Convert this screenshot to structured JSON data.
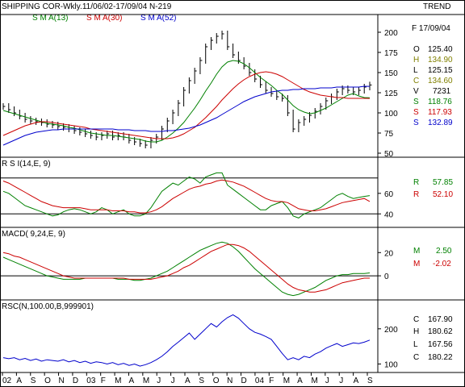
{
  "title": "SHIPPING COR-Wkly.11/06/02-17/09/04  N-219",
  "trend_label": "TREND",
  "colors": {
    "price": "#000000",
    "sma13": "#008000",
    "sma30": "#cc0000",
    "sma52": "#0000cc",
    "rsi": "#008000",
    "rsi_avg": "#cc0000",
    "macd": "#008000",
    "macd_signal": "#cc0000",
    "rsc": "#0000cc"
  },
  "legend": [
    {
      "label": "S M A(13)",
      "color": "#008000"
    },
    {
      "label": "S M A(30)",
      "color": "#cc0000"
    },
    {
      "label": "S M A(52)",
      "color": "#0000cc"
    }
  ],
  "readouts": {
    "date": "F 17/09/04",
    "price": [
      {
        "label": "O",
        "value": "125.40",
        "color": "#000000"
      },
      {
        "label": "H",
        "value": "134.90",
        "color": "#808000"
      },
      {
        "label": "L",
        "value": "125.15",
        "color": "#000000"
      },
      {
        "label": "C",
        "value": "134.60",
        "color": "#808000"
      },
      {
        "label": "V",
        "value": "7231",
        "color": "#000000"
      },
      {
        "label": "S",
        "value": "118.76",
        "color": "#008000"
      },
      {
        "label": "S",
        "value": "117.93",
        "color": "#cc0000"
      },
      {
        "label": "S",
        "value": "132.89",
        "color": "#0000cc"
      }
    ],
    "rsi": [
      {
        "label": "R",
        "value": "57.85",
        "color": "#008000"
      },
      {
        "label": "R",
        "value": "52.10",
        "color": "#cc0000"
      }
    ],
    "macd": [
      {
        "label": "M",
        "value": "2.50",
        "color": "#008000"
      },
      {
        "label": "M",
        "value": "-2.02",
        "color": "#cc0000"
      }
    ],
    "rsc": [
      {
        "label": "C",
        "value": "167.90",
        "color": "#000000"
      },
      {
        "label": "H",
        "value": "180.62",
        "color": "#000000"
      },
      {
        "label": "L",
        "value": "167.56",
        "color": "#000000"
      },
      {
        "label": "C",
        "value": "180.22",
        "color": "#000000"
      }
    ]
  },
  "chart_data": [
    {
      "type": "line",
      "panel": "price",
      "title": "SHIPPING COR-Wkly.11/06/02-17/09/04  N-219",
      "y_ticks": [
        50,
        75,
        100,
        125,
        150,
        175,
        200
      ],
      "ylim": [
        50,
        210
      ],
      "x_labels": [
        "02",
        "A",
        "S",
        "O",
        "N",
        "D",
        "03",
        "F",
        "M",
        "A",
        "M",
        "J",
        "J",
        "A",
        "S",
        "O",
        "N",
        "D",
        "04",
        "F",
        "M",
        "A",
        "M",
        "J",
        "J",
        "A",
        "S"
      ],
      "series": [
        {
          "name": "Price",
          "style": "bars",
          "values": [
            108,
            104,
            100,
            96,
            92,
            90,
            89,
            88,
            86,
            85,
            83,
            82,
            80,
            78,
            76,
            74,
            72,
            70,
            72,
            74,
            70,
            72,
            70,
            66,
            64,
            62,
            60,
            66,
            70,
            80,
            90,
            100,
            112,
            128,
            140,
            152,
            165,
            182,
            190,
            195,
            198,
            182,
            172,
            165,
            158,
            150,
            142,
            135,
            128,
            124,
            120,
            118,
            100,
            80,
            88,
            92,
            97,
            102,
            108,
            115,
            120,
            126,
            130,
            128,
            126,
            128,
            132,
            134.6
          ]
        },
        {
          "name": "S M A(13)",
          "values": [
            103,
            101,
            99,
            97,
            95,
            93,
            91,
            89,
            87,
            86,
            85,
            84,
            82,
            81,
            79,
            77,
            75,
            74,
            73,
            72,
            72,
            71,
            70,
            69,
            68,
            67,
            65,
            64,
            64,
            66,
            70,
            75,
            81,
            88,
            97,
            106,
            116,
            127,
            137,
            148,
            157,
            163,
            165,
            164,
            161,
            156,
            150,
            144,
            139,
            134,
            128,
            123,
            116,
            109,
            104,
            101,
            99,
            100,
            103,
            106,
            110,
            114,
            118,
            122,
            124,
            121,
            119,
            118.76
          ]
        },
        {
          "name": "S M A(30)",
          "values": [
            72,
            75,
            78,
            81,
            84,
            86,
            88,
            89,
            89,
            88,
            87,
            86,
            85,
            84,
            83,
            82,
            80,
            79,
            78,
            77,
            76,
            75,
            74,
            73,
            72,
            71,
            70,
            69,
            68,
            68,
            68,
            69,
            71,
            74,
            78,
            82,
            88,
            94,
            101,
            108,
            116,
            123,
            130,
            136,
            141,
            145,
            148,
            150,
            151,
            150,
            148,
            145,
            141,
            137,
            133,
            129,
            126,
            124,
            122,
            121,
            120,
            119,
            119,
            118,
            118,
            118,
            118,
            117.93
          ]
        },
        {
          "name": "S M A(52)",
          "values": [
            60,
            63,
            66,
            69,
            72,
            74,
            76,
            77,
            78,
            79,
            79,
            80,
            80,
            80,
            80,
            80,
            80,
            80,
            80,
            80,
            80,
            79,
            79,
            79,
            78,
            78,
            78,
            77,
            77,
            77,
            78,
            78,
            79,
            80,
            81,
            83,
            85,
            88,
            91,
            94,
            98,
            102,
            106,
            110,
            114,
            117,
            120,
            122,
            124,
            126,
            127,
            128,
            128,
            129,
            129,
            130,
            130,
            130,
            131,
            131,
            131,
            132,
            132,
            132,
            132,
            132,
            133,
            132.89
          ]
        }
      ]
    },
    {
      "type": "line",
      "panel": "rsi",
      "title": "R S I(14,E, 9)",
      "y_ticks": [
        40,
        60
      ],
      "ylim": [
        30,
        85
      ],
      "reference_lines": [
        75,
        40
      ],
      "series": [
        {
          "name": "RSI",
          "values": [
            62,
            60,
            56,
            52,
            48,
            46,
            44,
            42,
            40,
            38,
            39,
            42,
            44,
            45,
            44,
            42,
            40,
            42,
            46,
            44,
            40,
            42,
            44,
            40,
            38,
            38,
            40,
            46,
            54,
            62,
            66,
            70,
            68,
            72,
            76,
            74,
            70,
            76,
            78,
            80,
            80,
            68,
            64,
            60,
            56,
            52,
            48,
            44,
            44,
            48,
            50,
            52,
            46,
            38,
            36,
            40,
            42,
            44,
            46,
            50,
            54,
            58,
            60,
            57,
            55,
            56,
            57,
            57.85
          ]
        },
        {
          "name": "RSI avg",
          "values": [
            72,
            70,
            67,
            64,
            61,
            58,
            55,
            52,
            50,
            48,
            47,
            46,
            46,
            46,
            46,
            45,
            44,
            44,
            44,
            44,
            43,
            43,
            43,
            42,
            42,
            41,
            41,
            42,
            44,
            47,
            51,
            55,
            58,
            61,
            64,
            66,
            67,
            69,
            70,
            72,
            73,
            72,
            71,
            69,
            67,
            64,
            61,
            58,
            55,
            53,
            52,
            52,
            51,
            48,
            45,
            44,
            43,
            43,
            44,
            45,
            47,
            49,
            51,
            52,
            53,
            54,
            55,
            52.1
          ]
        }
      ]
    },
    {
      "type": "line",
      "panel": "macd",
      "title": "MACD( 9,24,E, 9)",
      "y_ticks": [
        20,
        0
      ],
      "ylim": [
        -18,
        32
      ],
      "reference_lines": [
        0
      ],
      "series": [
        {
          "name": "MACD",
          "values": [
            16,
            14,
            12,
            10,
            8,
            6,
            4,
            2,
            0,
            -1,
            -2,
            -3,
            -3,
            -3,
            -3,
            -2,
            -2,
            -2,
            -2,
            -2,
            -2,
            -3,
            -3,
            -3,
            -4,
            -4,
            -3,
            -2,
            0,
            2,
            4,
            7,
            10,
            13,
            16,
            19,
            22,
            24,
            26,
            28,
            29,
            28,
            25,
            21,
            16,
            11,
            6,
            2,
            -2,
            -6,
            -10,
            -14,
            -16,
            -17,
            -16,
            -14,
            -12,
            -10,
            -7,
            -4,
            -2,
            0,
            1,
            1,
            2,
            2,
            2,
            2.5
          ]
        },
        {
          "name": "Signal",
          "values": [
            20,
            19,
            17,
            16,
            14,
            12,
            10,
            8,
            6,
            4,
            2,
            0,
            -1,
            -2,
            -2,
            -2,
            -2,
            -2,
            -2,
            -2,
            -2,
            -2,
            -2,
            -3,
            -3,
            -3,
            -3,
            -3,
            -2,
            -1,
            0,
            2,
            4,
            7,
            9,
            12,
            15,
            18,
            21,
            23,
            25,
            27,
            27,
            26,
            24,
            21,
            17,
            13,
            9,
            5,
            1,
            -3,
            -7,
            -10,
            -12,
            -13,
            -14,
            -14,
            -13,
            -12,
            -10,
            -8,
            -6,
            -5,
            -4,
            -3,
            -2,
            -2.02
          ]
        }
      ]
    },
    {
      "type": "line",
      "panel": "rsc",
      "title": "RSC(N,100.00,B,999901)",
      "y_ticks": [
        100,
        200
      ],
      "ylim": [
        85,
        250
      ],
      "series": [
        {
          "name": "RSC",
          "values": [
            118,
            115,
            118,
            112,
            116,
            110,
            114,
            108,
            112,
            110,
            108,
            112,
            106,
            110,
            104,
            108,
            102,
            106,
            104,
            100,
            104,
            98,
            102,
            96,
            100,
            94,
            98,
            104,
            112,
            122,
            135,
            150,
            162,
            175,
            188,
            170,
            185,
            200,
            215,
            205,
            220,
            232,
            240,
            230,
            215,
            200,
            190,
            185,
            178,
            170,
            150,
            130,
            112,
            118,
            112,
            122,
            118,
            128,
            135,
            145,
            152,
            158,
            150,
            155,
            160,
            158,
            162,
            167.9
          ]
        }
      ]
    }
  ]
}
